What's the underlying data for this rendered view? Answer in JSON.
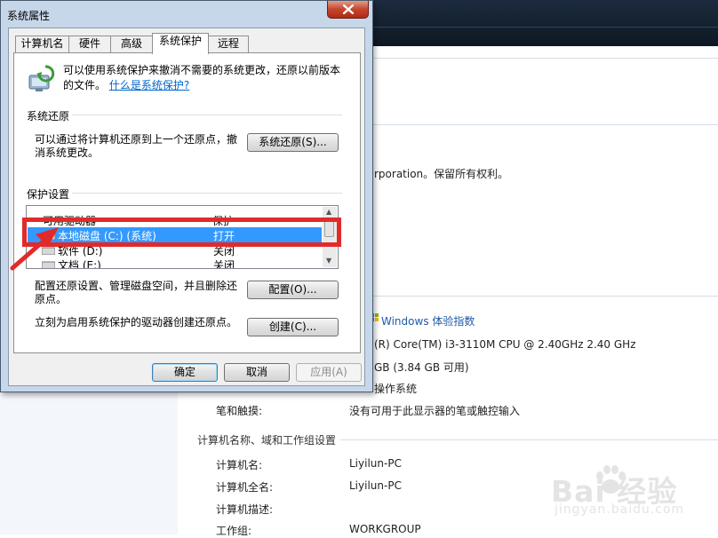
{
  "dialog": {
    "title": "系统属性",
    "tabs": [
      "计算机名",
      "硬件",
      "高级",
      "系统保护",
      "远程"
    ],
    "active_tab": 3,
    "intro_text": "可以使用系统保护来撤消不需要的系统更改，还原以前版本的文件。",
    "intro_link": "什么是系统保护?",
    "restore": {
      "group_label": "系统还原",
      "description": "可以通过将计算机还原到上一个还原点，撤消系统更改。",
      "button": "系统还原(S)..."
    },
    "protection": {
      "group_label": "保护设置",
      "columns": [
        "可用驱动器",
        "保护"
      ],
      "drives": [
        {
          "name": "本地磁盘 (C:) (系统)",
          "protection": "打开",
          "selected": true
        },
        {
          "name": "软件 (D:)",
          "protection": "关闭",
          "selected": false
        },
        {
          "name": "文档 (E:)",
          "protection": "关闭",
          "selected": false
        }
      ]
    },
    "configure": {
      "description": "配置还原设置、管理磁盘空间，并且删除还原点。",
      "button": "配置(O)..."
    },
    "create": {
      "description": "立刻为启用系统保护的驱动器创建还原点。",
      "button": "创建(C)..."
    },
    "footer": {
      "ok": "确定",
      "cancel": "取消",
      "apply": "应用(A)"
    }
  },
  "background": {
    "copyright": "rporation。保留所有权利。",
    "rating": "Windows 体验指数",
    "processor": "(R) Core(TM) i3-3110M CPU @ 2.40GHz   2.40 GHz",
    "memory": "GB (3.84 GB 可用)",
    "system_type": "操作系统",
    "pen_label": "笔和触摸:",
    "pen_value": "没有可用于此显示器的笔或触控输入",
    "section_title": "计算机名称、域和工作组设置",
    "computer_name_label": "计算机名:",
    "computer_name_value": "Liyilun-PC",
    "full_name_label": "计算机全名:",
    "full_name_value": "Liyilun-PC",
    "description_label": "计算机描述:",
    "workgroup_label": "工作组:",
    "workgroup_value": "WORKGROUP"
  },
  "watermark": {
    "main": "Bai  经验",
    "sub": "jingyan.baidu.com"
  },
  "colors": {
    "selection": "#3399ff",
    "annotation": "#e12a2a",
    "link": "#0066cc"
  }
}
